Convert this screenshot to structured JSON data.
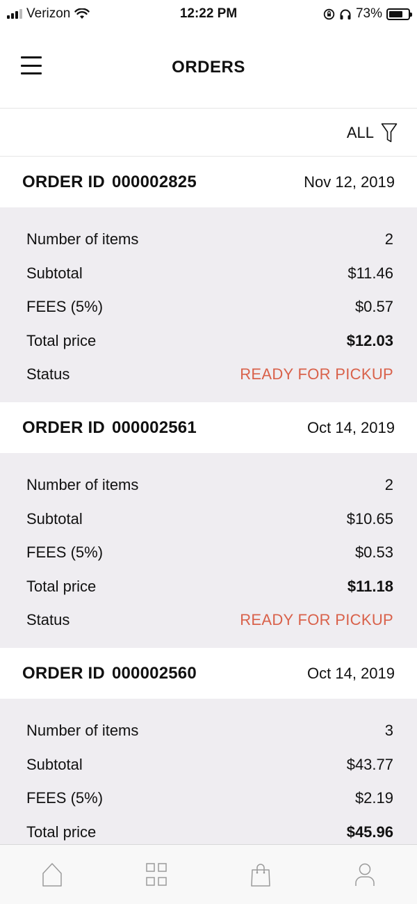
{
  "status_bar": {
    "carrier": "Verizon",
    "time": "12:22 PM",
    "battery": "73%",
    "battery_level": 0.73
  },
  "header": {
    "title": "ORDERS"
  },
  "filter": {
    "label": "ALL"
  },
  "orders": [
    {
      "id_label": "ORDER ID",
      "id": "000002825",
      "date": "Nov 12, 2019",
      "rows": [
        {
          "label": "Number of items",
          "value": "2"
        },
        {
          "label": "Subtotal",
          "value": "$11.46"
        },
        {
          "label": "FEES (5%)",
          "value": "$0.57"
        },
        {
          "label": "Total price",
          "value": "$12.03"
        },
        {
          "label": "Status",
          "value": "READY FOR PICKUP"
        }
      ]
    },
    {
      "id_label": "ORDER ID",
      "id": "000002561",
      "date": "Oct 14, 2019",
      "rows": [
        {
          "label": "Number of items",
          "value": "2"
        },
        {
          "label": "Subtotal",
          "value": "$10.65"
        },
        {
          "label": "FEES (5%)",
          "value": "$0.53"
        },
        {
          "label": "Total price",
          "value": "$11.18"
        },
        {
          "label": "Status",
          "value": "READY FOR PICKUP"
        }
      ]
    },
    {
      "id_label": "ORDER ID",
      "id": "000002560",
      "date": "Oct 14, 2019",
      "rows": [
        {
          "label": "Number of items",
          "value": "3"
        },
        {
          "label": "Subtotal",
          "value": "$43.77"
        },
        {
          "label": "FEES (5%)",
          "value": "$2.19"
        },
        {
          "label": "Total price",
          "value": "$45.96"
        }
      ]
    }
  ],
  "colors": {
    "status": "#d9614a",
    "card_background": "#efedf1"
  },
  "tab_bar": {
    "icons": [
      "home-icon",
      "grid-icon",
      "shopping-bag-icon",
      "user-icon"
    ]
  }
}
